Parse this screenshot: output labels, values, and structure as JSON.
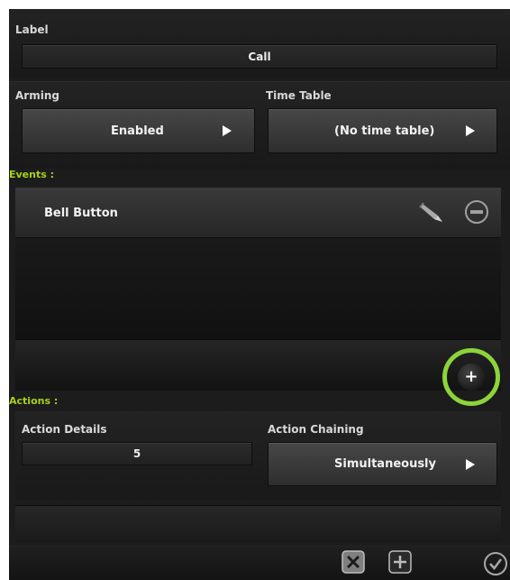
{
  "label_section": {
    "title": "Label",
    "value": "Call"
  },
  "arming": {
    "title": "Arming",
    "value": "Enabled"
  },
  "time_table": {
    "title": "Time Table",
    "value": "(No time table)"
  },
  "events": {
    "title": "Events :",
    "items": [
      {
        "label": "Bell Button"
      }
    ],
    "add_label": "+"
  },
  "actions": {
    "title": "Actions :",
    "details_title": "Action Details",
    "details_value": "5",
    "chaining_title": "Action Chaining",
    "chaining_value": "Simultaneously"
  },
  "colors": {
    "background": "#1c1c1c",
    "section_title": "#a6d219",
    "highlight_ring": "#8dd33a"
  }
}
